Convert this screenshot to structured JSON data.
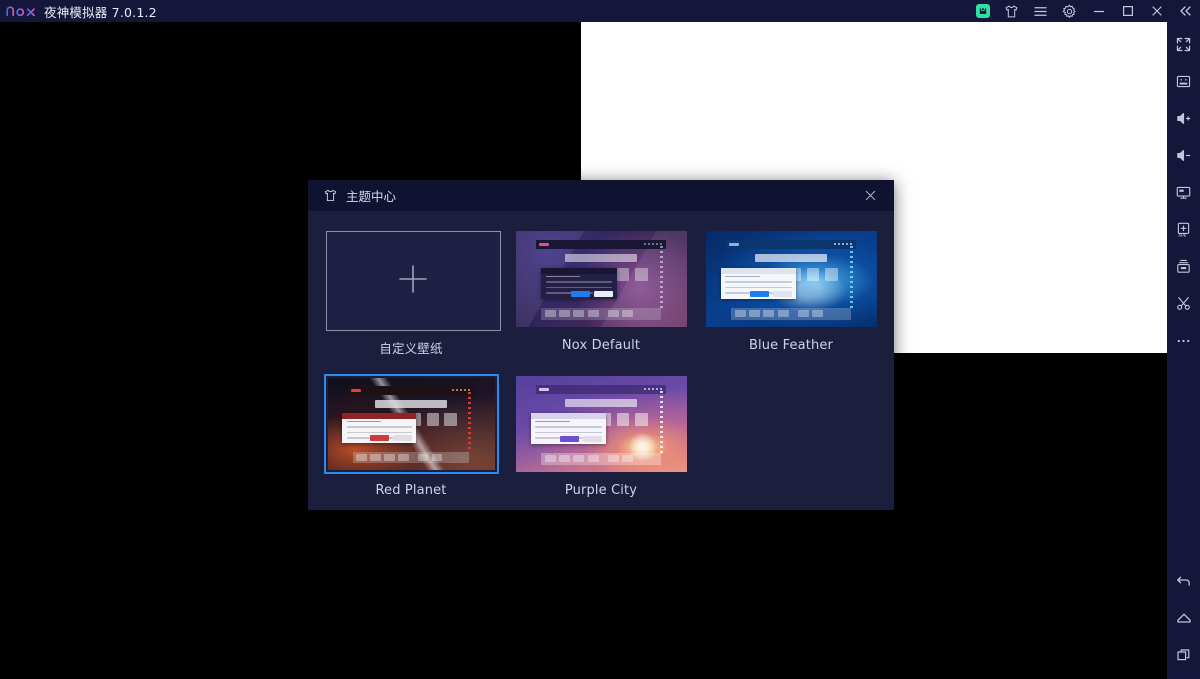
{
  "window": {
    "logo_text": "nox",
    "title": "夜神模拟器 7.0.1.2",
    "titlebar_color": "#141739",
    "controls": [
      {
        "name": "store-icon",
        "label": "App Store"
      },
      {
        "name": "theme-icon",
        "label": "Theme Center"
      },
      {
        "name": "menu-icon",
        "label": "Menu"
      },
      {
        "name": "settings-icon",
        "label": "Settings"
      },
      {
        "name": "minimize-icon",
        "label": "Minimize"
      },
      {
        "name": "maximize-icon",
        "label": "Maximize"
      },
      {
        "name": "close-icon",
        "label": "Close"
      },
      {
        "name": "collapse-icon",
        "label": "Collapse toolbar"
      }
    ]
  },
  "rail": {
    "background": "#141739",
    "top_items": [
      {
        "name": "fullscreen-icon",
        "label": "Fullscreen"
      },
      {
        "name": "keyboard-icon",
        "label": "Keyboard mapping"
      },
      {
        "name": "volume-up-icon",
        "label": "Volume up"
      },
      {
        "name": "volume-down-icon",
        "label": "Volume down"
      },
      {
        "name": "screen-rotate-icon",
        "label": "Screen"
      },
      {
        "name": "install-apk-icon",
        "label": "Install APK"
      },
      {
        "name": "shared-folder-icon",
        "label": "Shared folder"
      },
      {
        "name": "screenshot-icon",
        "label": "Screenshot"
      },
      {
        "name": "more-icon",
        "label": "More"
      }
    ],
    "bottom_items": [
      {
        "name": "back-icon",
        "label": "Back"
      },
      {
        "name": "home-icon",
        "label": "Home"
      },
      {
        "name": "recents-icon",
        "label": "Recent apps"
      }
    ]
  },
  "dialog": {
    "title": "主题中心",
    "title_icon": "shirt-icon",
    "close_icon": "close-icon",
    "titlebar_color": "#0f1230",
    "body_color": "#1b1e3c",
    "selection_color": "#2b8cf0",
    "themes": [
      {
        "id": "custom",
        "label": "自定义壁纸",
        "type": "add",
        "selected": false
      },
      {
        "id": "nox-default",
        "label": "Nox Default",
        "type": "theme",
        "selected": false
      },
      {
        "id": "blue-feather",
        "label": "Blue Feather",
        "type": "theme",
        "selected": false
      },
      {
        "id": "red-planet",
        "label": "Red Planet",
        "type": "theme",
        "selected": true
      },
      {
        "id": "purple-city",
        "label": "Purple City",
        "type": "theme",
        "selected": false
      }
    ]
  }
}
